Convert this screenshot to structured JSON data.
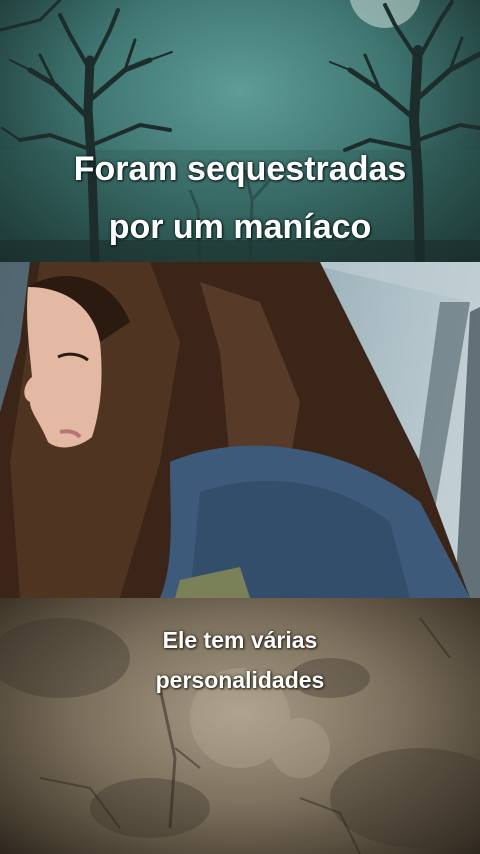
{
  "panels": {
    "top": {
      "caption_line1": "Foram sequestradas",
      "caption_line2": "por um maníaco",
      "colors": {
        "sky": "#4f8a85",
        "trees": "#1c2d2b"
      }
    },
    "middle": {
      "scene": "girl-in-car-photo",
      "colors": {
        "hair": "#3a2518",
        "hoodie": "#3e5a7a",
        "window": "#b7c8cf"
      }
    },
    "bottom": {
      "caption_line1": "Ele tem várias",
      "caption_line2": "personalidades",
      "colors": {
        "texture": "#7e725f"
      }
    }
  }
}
